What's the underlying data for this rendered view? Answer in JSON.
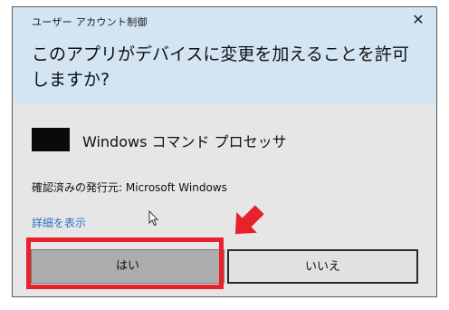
{
  "window": {
    "title": "ユーザー アカウント制御",
    "close_glyph": "✕"
  },
  "prompt": {
    "question": "このアプリがデバイスに変更を加えることを許可しますか?"
  },
  "app": {
    "icon": "command-prompt-icon",
    "name": "Windows コマンド プロセッサ"
  },
  "publisher": {
    "text": "確認済みの発行元: Microsoft Windows"
  },
  "details": {
    "link_label": "詳細を表示"
  },
  "buttons": {
    "yes_label": "はい",
    "no_label": "いいえ"
  },
  "annotations": {
    "highlight_color": "#e8212b",
    "arrow_color": "#e8212b"
  },
  "colors": {
    "header_bg": "#d3e5f3",
    "body_bg": "#e6e6e6",
    "link": "#2b73c2"
  }
}
